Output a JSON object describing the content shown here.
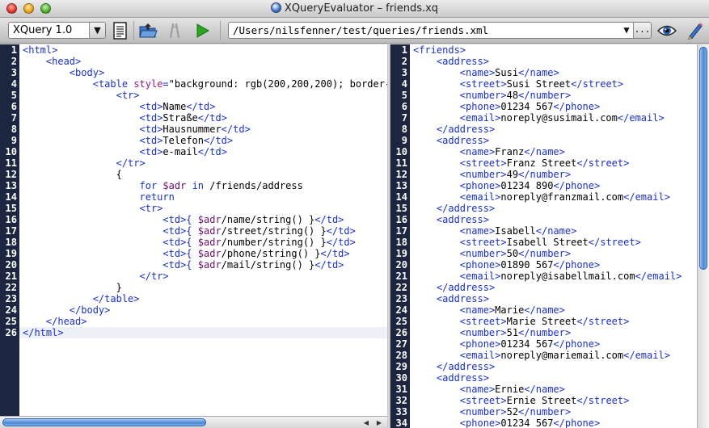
{
  "window": {
    "title": "XQueryEvaluator – friends.xq"
  },
  "toolbar": {
    "language": "XQuery 1.0",
    "path": "/Users/nilsfenner/test/queries/friends.xml",
    "more_label": "...",
    "icons": [
      "document-icon",
      "open-folder-icon",
      "stop-icon",
      "run-icon",
      "eye-icon",
      "pencil-icon"
    ]
  },
  "editor": {
    "line_numbers": [
      "1",
      "2",
      "3",
      "4",
      "5",
      "6",
      "7",
      "8",
      "9",
      "10",
      "11",
      "12",
      "13",
      "14",
      "15",
      "16",
      "17",
      "18",
      "19",
      "20",
      "21",
      "22",
      "23",
      "24",
      "25",
      "26"
    ],
    "highlighted_line": 26
  },
  "output": {
    "line_numbers": [
      "1",
      "2",
      "3",
      "4",
      "5",
      "6",
      "7",
      "8",
      "9",
      "10",
      "11",
      "12",
      "13",
      "14",
      "15",
      "16",
      "17",
      "18",
      "19",
      "20",
      "21",
      "22",
      "23",
      "24",
      "25",
      "26",
      "27",
      "28",
      "29",
      "30",
      "31",
      "32",
      "33",
      "34"
    ]
  },
  "colors": {
    "gutter": "#1c2640",
    "tag": "#1a30c8",
    "variable": "#6a0f6a",
    "keyword": "#1a30c8"
  }
}
